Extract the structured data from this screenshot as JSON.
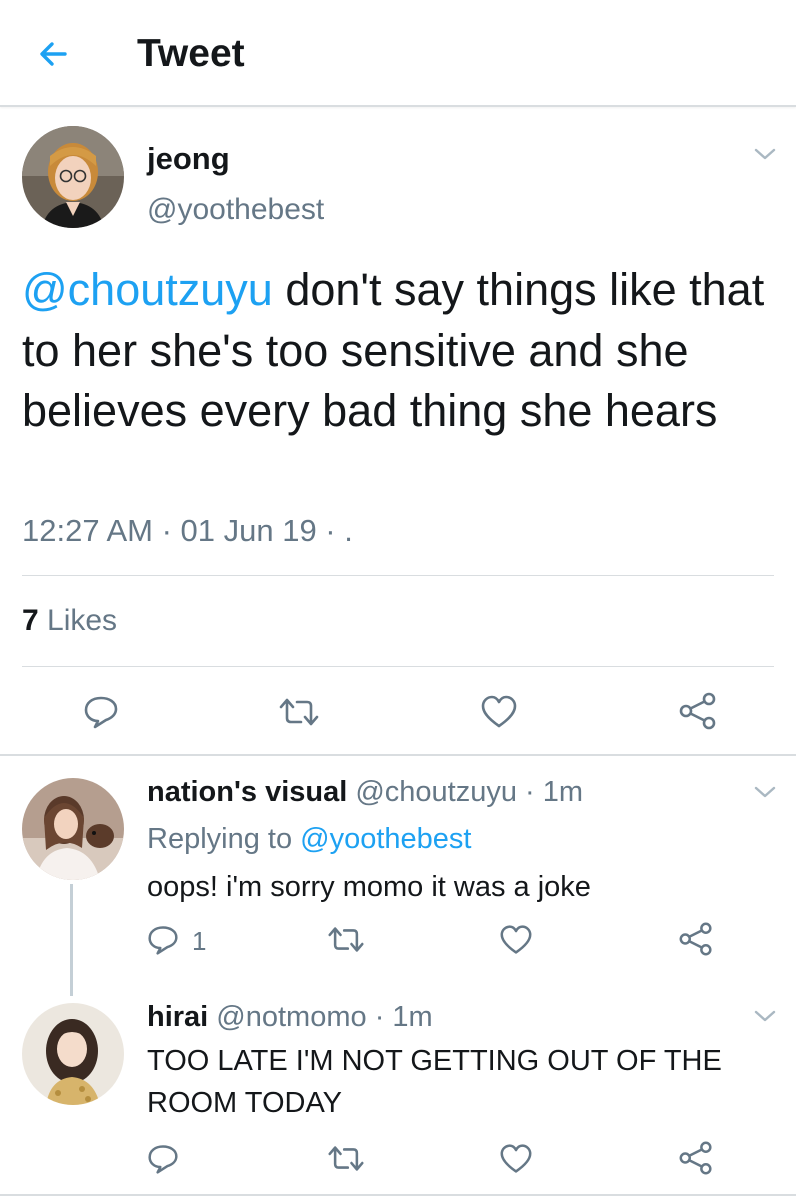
{
  "header": {
    "title": "Tweet",
    "back_icon": "back-arrow-icon"
  },
  "colors": {
    "accent": "#1da1f2",
    "text": "#14171a",
    "secondary": "#657786",
    "divider": "#d9dde0"
  },
  "main_tweet": {
    "display_name": "jeong",
    "handle": "@yoothebest",
    "mention": "@choutzuyu",
    "text": " don't say things like that to her she's too sensitive and she believes every bad thing she hears",
    "timestamp": "12:27 AM · 01 Jun 19 · .",
    "likes_count": "7",
    "likes_label": " Likes"
  },
  "replies": [
    {
      "display_name": "nation's visual",
      "handle_time": " @choutzuyu · 1m",
      "replying_prefix": "Replying to ",
      "replying_to": "@yoothebest",
      "text": "oops! i'm sorry momo it was a joke",
      "reply_count": "1"
    },
    {
      "display_name": "hirai",
      "handle_time": " @notmomo · 1m",
      "text": "TOO LATE I'M NOT GETTING OUT OF THE ROOM TODAY",
      "reply_count": ""
    }
  ]
}
